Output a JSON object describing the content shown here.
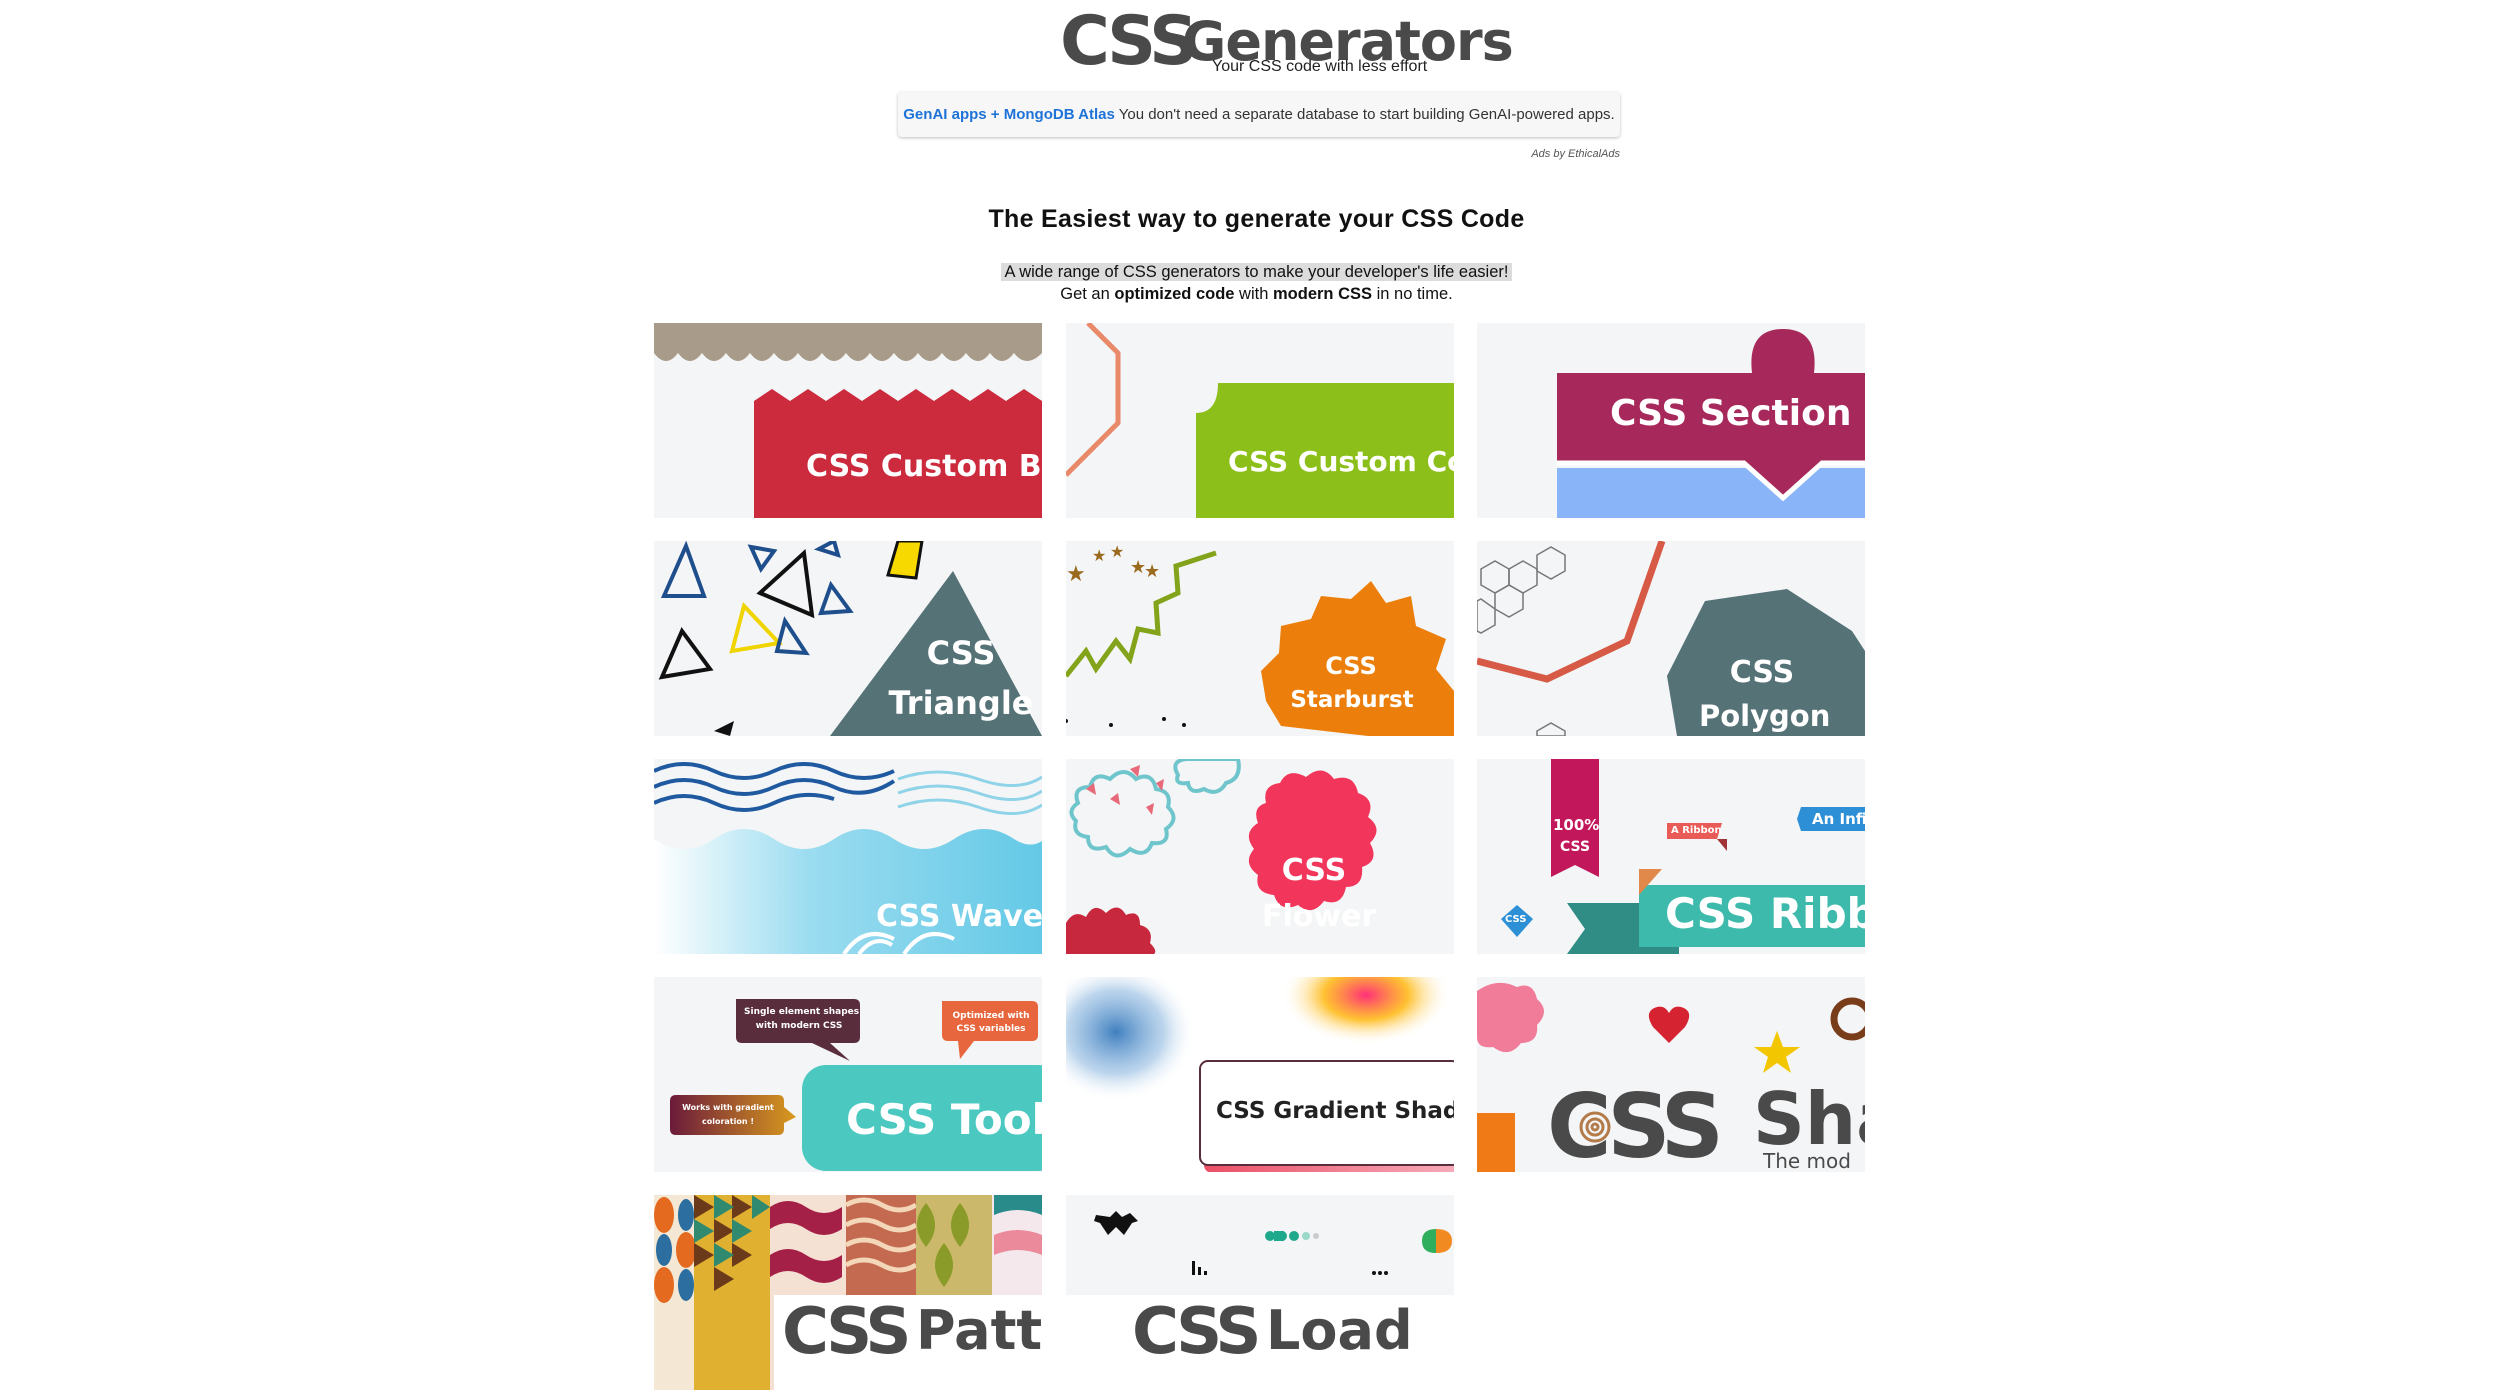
{
  "header": {
    "logo_css": "CSS",
    "logo_title": "Generators",
    "tagline": "Your CSS code with less effort"
  },
  "ad": {
    "link_text": "GenAI apps + MongoDB Atlas",
    "body_text": "You don't need a separate database to start building GenAI-powered apps.",
    "credit": "Ads by EthicalAds"
  },
  "main": {
    "headline": "The Easiest way to generate your CSS Code",
    "subtitle_line1": "A wide range of CSS generators to make your developer's life easier!",
    "subtitle_line2_pre": "Get an ",
    "subtitle_line2_b1": "optimized code",
    "subtitle_line2_mid": " with ",
    "subtitle_line2_b2": "modern CSS",
    "subtitle_line2_post": " in no time."
  },
  "cards": [
    {
      "label": "CSS Custom Bor"
    },
    {
      "label": "CSS Custom Cor"
    },
    {
      "label": "CSS Section Di"
    },
    {
      "label_1": "CSS",
      "label_2": "Triangle"
    },
    {
      "label_1": "CSS",
      "label_2": "Starburst"
    },
    {
      "label_1": "CSS",
      "label_2": "Polygon"
    },
    {
      "label": "CSS Waves"
    },
    {
      "label_1": "CSS",
      "label_2": "Flower"
    },
    {
      "label": "CSS Ribbo",
      "tag_100": "100%",
      "tag_css": "CSS",
      "tag_ribbon": "A Ribbon",
      "tag_infinite": "An Infi",
      "tag_small_css": "CSS"
    },
    {
      "label": "CSS Toolti",
      "bubble_1": "Single element shapes",
      "bubble_1b": "with modern CSS",
      "bubble_2": "Optimized with",
      "bubble_2b": "CSS variables",
      "bubble_3": "Works with gradient",
      "bubble_3b": "coloration !"
    },
    {
      "label": "CSS Gradient Shado"
    },
    {
      "label_css": "CSS",
      "label_sha": "Sha",
      "sub": "The mod"
    },
    {
      "label_css": "CSS",
      "label": "Patte"
    },
    {
      "label_css": "CSS",
      "label": "Load"
    }
  ],
  "colors": {
    "link_blue": "#1e73d8",
    "logo_gray": "#4a4a4a",
    "logo_tan": "#c8935c"
  }
}
